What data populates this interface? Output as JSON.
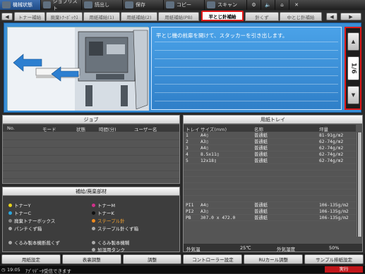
{
  "topbar": [
    {
      "label": "機械状態",
      "active": true,
      "icon": "printer-icon"
    },
    {
      "label": "ジョブリスト",
      "icon": "list-icon"
    },
    {
      "label": "読出し",
      "icon": "folder-icon"
    },
    {
      "label": "保存",
      "icon": "save-icon"
    },
    {
      "label": "コピー",
      "icon": "copy-icon"
    },
    {
      "label": "スキャン",
      "icon": "scan-icon"
    }
  ],
  "tabs": [
    "トナー補給",
    "廃棄ﾄﾅｰﾎﾞｯｸｽ",
    "用紙補給(1)",
    "用紙補給(2)",
    "用紙補給(PB)",
    "平とじ針補給",
    "針くず",
    "中とじ針補給"
  ],
  "guide": {
    "message": "平とじ機の前扉を開けて、スタッカーを引き出します。",
    "page": "1/6"
  },
  "job": {
    "title": "ジョブ",
    "headers": [
      "No.",
      "モード",
      "状態",
      "時間(分)",
      "ユーザー名"
    ]
  },
  "tray": {
    "title": "用紙トレイ",
    "headers": [
      "トレイ",
      "サイズ(mm)",
      "名称",
      "坪量"
    ],
    "rows": [
      [
        "1",
        "A4▯",
        "普通紙",
        "81-91g/m2"
      ],
      [
        "2",
        "A3▯",
        "普通紙",
        "62-74g/m2"
      ],
      [
        "3",
        "A4▯",
        "普通紙",
        "62-74g/m2"
      ],
      [
        "4",
        "8.5x11▯",
        "普通紙",
        "62-74g/m2"
      ],
      [
        "5",
        "12x18▯",
        "普通紙",
        "62-74g/m2"
      ],
      [
        "",
        "",
        "",
        ""
      ],
      [
        "",
        "",
        "",
        ""
      ],
      [
        "",
        "",
        "",
        ""
      ],
      [
        "",
        "",
        "",
        ""
      ],
      [
        "",
        "",
        "",
        ""
      ],
      [
        "",
        "",
        "",
        ""
      ],
      [
        "PI1",
        "A4▯",
        "普通紙",
        "106-135g/m2"
      ],
      [
        "PI2",
        "A3▯",
        "普通紙",
        "106-135g/m2"
      ],
      [
        "PB",
        "307.0 x 472.0",
        "普通紙",
        "106-135g/m2"
      ]
    ],
    "temp_label": "外気温",
    "temp_value": "25℃",
    "humidity_label": "外気湿度",
    "humidity_value": "50%"
  },
  "supplies": {
    "title": "補給/廃棄部材",
    "items": [
      {
        "label": "トナーY",
        "color": "#e8d21a"
      },
      {
        "label": "トナーM",
        "color": "#d0308a"
      },
      {
        "label": "トナーC",
        "color": "#2aa8e0"
      },
      {
        "label": "トナーK",
        "color": "#111111"
      },
      {
        "label": "廃棄トナーボックス",
        "color": "#888888"
      },
      {
        "label": "ステープル針",
        "color": "#f08a1c"
      },
      {
        "label": "パンチくず箱",
        "color": "#aaaaaa"
      },
      {
        "label": "ステープル針くず箱",
        "color": "#aaaaaa"
      },
      {
        "label": "くるみ製本機断裁くず",
        "color": "#aaaaaa"
      },
      {
        "label": "くるみ製本機糊",
        "color": "#aaaaaa"
      },
      {
        "label": "加湿用タンク",
        "color": "#aaaaaa"
      }
    ]
  },
  "bottom_buttons": [
    "用紙設定",
    "表裏調整",
    "調整",
    "コントローラー設定",
    "RUカール調整",
    "サンプル排紙設定"
  ],
  "status": {
    "time": "19:05",
    "message": "ｱﾌﾟﾘﾃﾞｰﾀ受信できます",
    "badge": "実行"
  }
}
